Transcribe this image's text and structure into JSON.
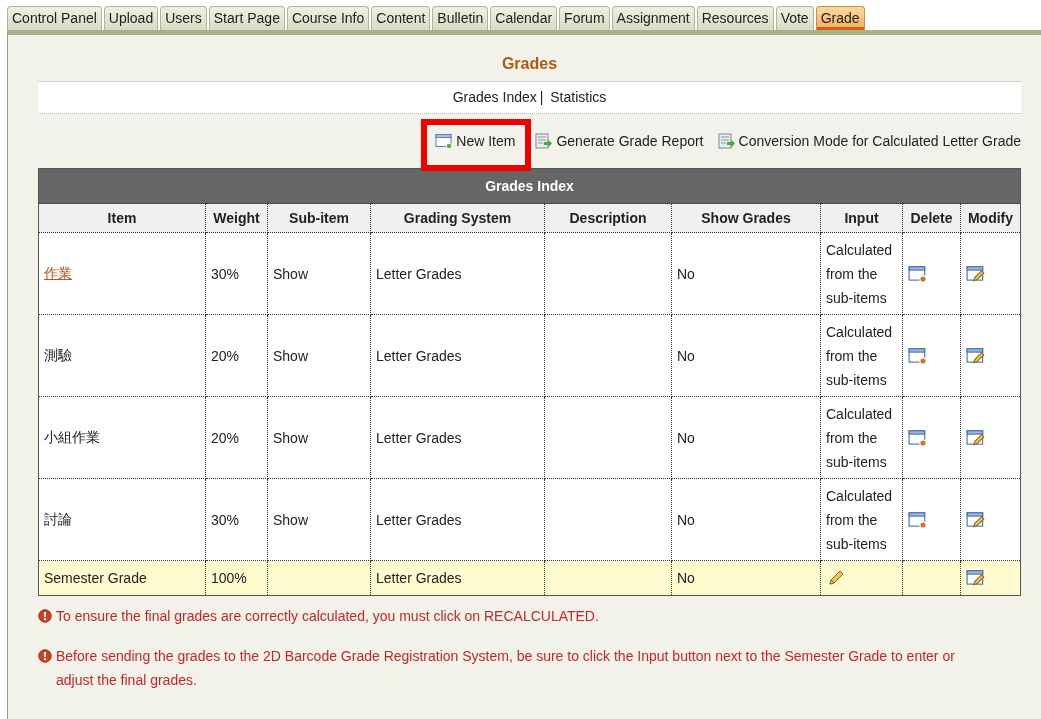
{
  "tabs": [
    {
      "label": "Control Panel",
      "selected": false
    },
    {
      "label": "Upload",
      "selected": false
    },
    {
      "label": "Users",
      "selected": false
    },
    {
      "label": "Start Page",
      "selected": false
    },
    {
      "label": "Course Info",
      "selected": false
    },
    {
      "label": "Content",
      "selected": false
    },
    {
      "label": "Bulletin",
      "selected": false
    },
    {
      "label": "Calendar",
      "selected": false
    },
    {
      "label": "Forum",
      "selected": false
    },
    {
      "label": "Assignment",
      "selected": false
    },
    {
      "label": "Resources",
      "selected": false
    },
    {
      "label": "Vote",
      "selected": false
    },
    {
      "label": "Grade",
      "selected": true
    }
  ],
  "page_title": "Grades",
  "subnav": [
    {
      "label": "Grades Index"
    },
    {
      "label": "Statistics"
    }
  ],
  "subnav_separator": "|",
  "toolbar": [
    {
      "label": "New Item",
      "kind": "new",
      "highlighted": true
    },
    {
      "label": "Generate Grade Report",
      "kind": "report",
      "highlighted": false
    },
    {
      "label": "Conversion Mode for Calculated Letter Grade",
      "kind": "report",
      "highlighted": false
    }
  ],
  "table": {
    "title": "Grades Index",
    "columns": [
      "Item",
      "Weight",
      "Sub-item",
      "Grading System",
      "Description",
      "Show Grades",
      "Input",
      "Delete",
      "Modify"
    ],
    "rows": [
      {
        "kind": "item",
        "item": "作業",
        "link": true,
        "weight": "30%",
        "sub_item": "Show",
        "grading_system": "Letter Grades",
        "show_grades": "No",
        "input": "Calculated from the sub-items"
      },
      {
        "kind": "item",
        "item": "測驗",
        "link": false,
        "weight": "20%",
        "sub_item": "Show",
        "grading_system": "Letter Grades",
        "show_grades": "No",
        "input": "Calculated from the sub-items"
      },
      {
        "kind": "item",
        "item": "小組作業",
        "link": false,
        "weight": "20%",
        "sub_item": "Show",
        "grading_system": "Letter Grades",
        "show_grades": "No",
        "input": "Calculated from the sub-items"
      },
      {
        "kind": "item",
        "item": "討論",
        "link": false,
        "weight": "30%",
        "sub_item": "Show",
        "grading_system": "Letter Grades",
        "show_grades": "No",
        "input": "Calculated from the sub-items"
      },
      {
        "kind": "total",
        "item": "Semester Grade",
        "link": false,
        "weight": "100%",
        "grading_system": "Letter Grades",
        "show_grades": "No"
      }
    ]
  },
  "notices": [
    "To ensure the final grades are correctly calculated, you must click on RECALCULATED.",
    "Before sending the grades to the 2D Barcode Grade Registration System, be sure to click the Input button next to the Semester Grade to enter or adjust the final grades."
  ]
}
